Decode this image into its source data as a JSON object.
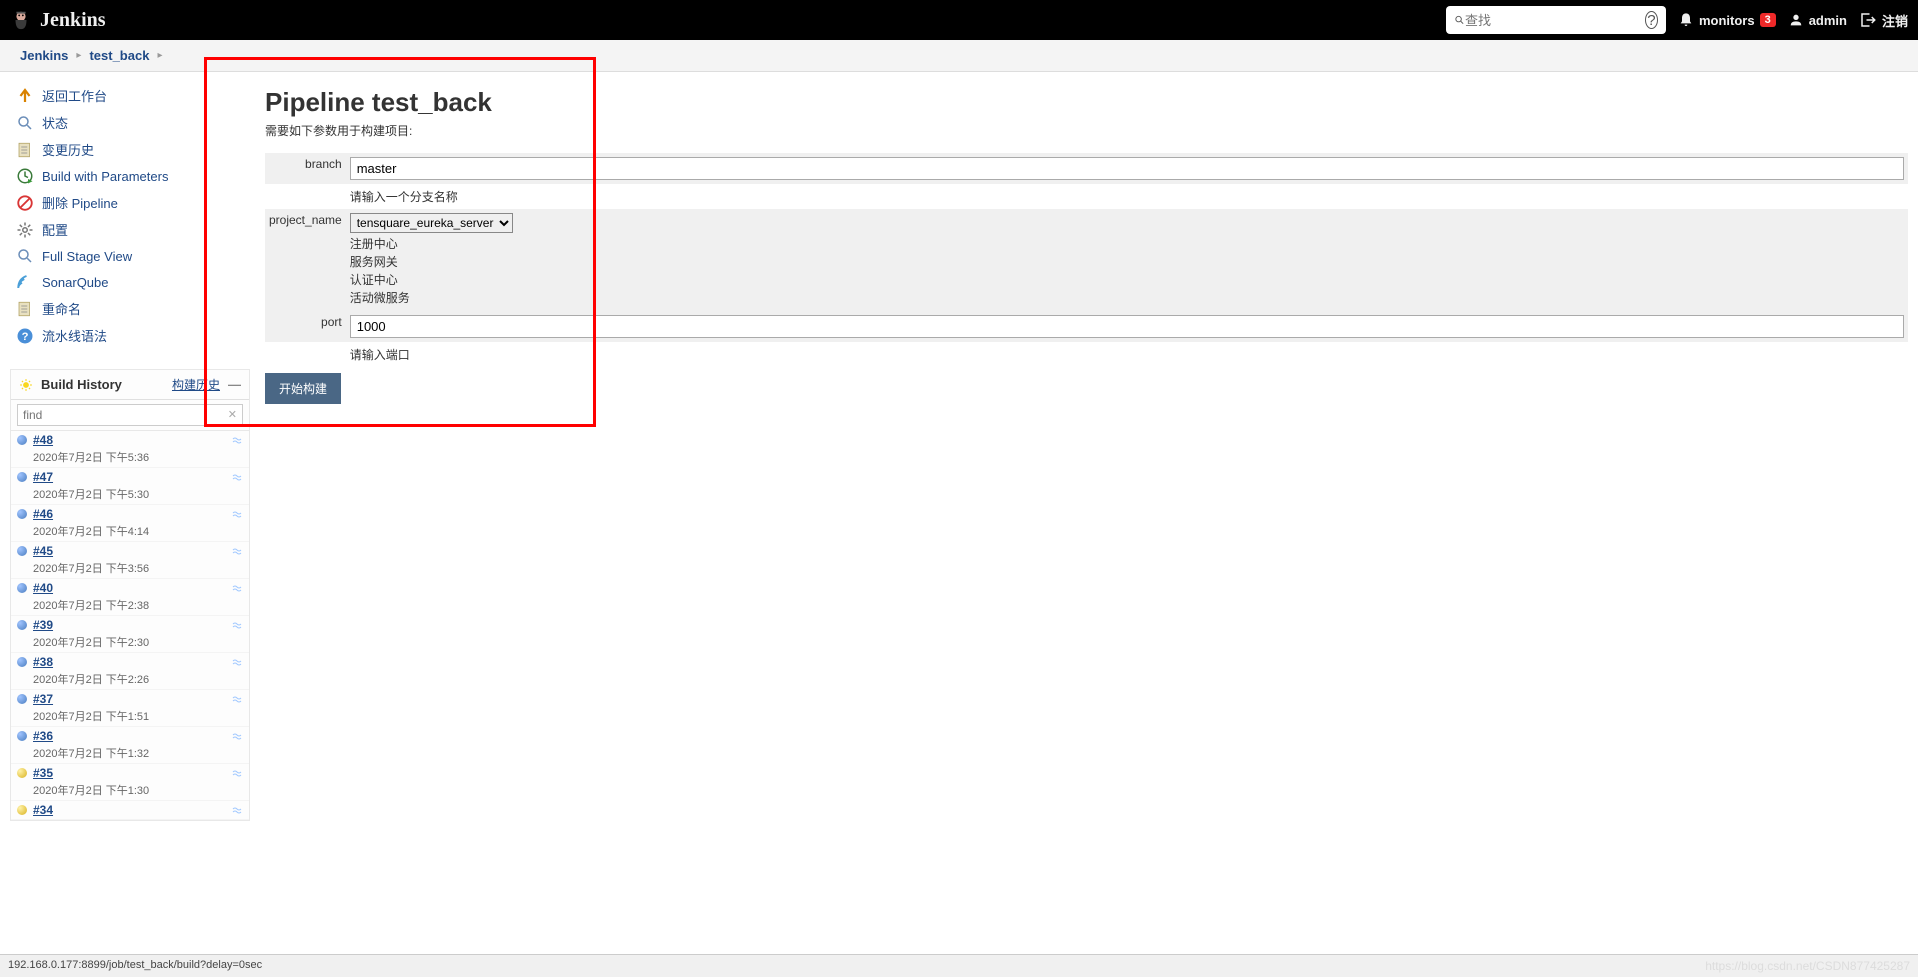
{
  "header": {
    "brand": "Jenkins",
    "search_placeholder": "查找",
    "monitors_label": "monitors",
    "monitors_count": "3",
    "user_label": "admin",
    "logout_label": "注销"
  },
  "breadcrumb": {
    "root": "Jenkins",
    "item": "test_back"
  },
  "sidebar": {
    "tasks": [
      {
        "id": "back",
        "label": "返回工作台",
        "icon": "arrow-up"
      },
      {
        "id": "status",
        "label": "状态",
        "icon": "search"
      },
      {
        "id": "changes",
        "label": "变更历史",
        "icon": "notepad"
      },
      {
        "id": "build-params",
        "label": "Build with Parameters",
        "icon": "clock-play"
      },
      {
        "id": "delete-pipeline",
        "label": "删除 Pipeline",
        "icon": "forbidden"
      },
      {
        "id": "configure",
        "label": "配置",
        "icon": "gear"
      },
      {
        "id": "full-stage",
        "label": "Full Stage View",
        "icon": "search"
      },
      {
        "id": "sonarqube",
        "label": "SonarQube",
        "icon": "sonar"
      },
      {
        "id": "rename",
        "label": "重命名",
        "icon": "notepad"
      },
      {
        "id": "syntax",
        "label": "流水线语法",
        "icon": "question"
      }
    ]
  },
  "build_history": {
    "title": "Build History",
    "trend_label": "构建历史",
    "search_placeholder": "find",
    "items": [
      {
        "num": "#48",
        "time": "2020年7月2日 下午5:36",
        "ball": "blue"
      },
      {
        "num": "#47",
        "time": "2020年7月2日 下午5:30",
        "ball": "blue"
      },
      {
        "num": "#46",
        "time": "2020年7月2日 下午4:14",
        "ball": "blue"
      },
      {
        "num": "#45",
        "time": "2020年7月2日 下午3:56",
        "ball": "blue"
      },
      {
        "num": "#40",
        "time": "2020年7月2日 下午2:38",
        "ball": "blue"
      },
      {
        "num": "#39",
        "time": "2020年7月2日 下午2:30",
        "ball": "blue"
      },
      {
        "num": "#38",
        "time": "2020年7月2日 下午2:26",
        "ball": "blue"
      },
      {
        "num": "#37",
        "time": "2020年7月2日 下午1:51",
        "ball": "blue"
      },
      {
        "num": "#36",
        "time": "2020年7月2日 下午1:32",
        "ball": "blue"
      },
      {
        "num": "#35",
        "time": "2020年7月2日 下午1:30",
        "ball": "yellow"
      },
      {
        "num": "#34",
        "time": "",
        "ball": "yellow"
      }
    ]
  },
  "main": {
    "title": "Pipeline test_back",
    "subtitle": "需要如下参数用于构建项目:",
    "params": {
      "branch": {
        "label": "branch",
        "value": "master",
        "help": "请输入一个分支名称"
      },
      "project_name": {
        "label": "project_name",
        "selected": "tensquare_eureka_server",
        "options_display": [
          "注册中心",
          "服务网关",
          "认证中心",
          "活动微服务"
        ]
      },
      "port": {
        "label": "port",
        "value": "1000",
        "help": "请输入端口"
      }
    },
    "build_button": "开始构建"
  },
  "statusbar": {
    "url": "192.168.0.177:8899/job/test_back/build?delay=0sec",
    "watermark": "https://blog.csdn.net/CSDN877425287"
  }
}
